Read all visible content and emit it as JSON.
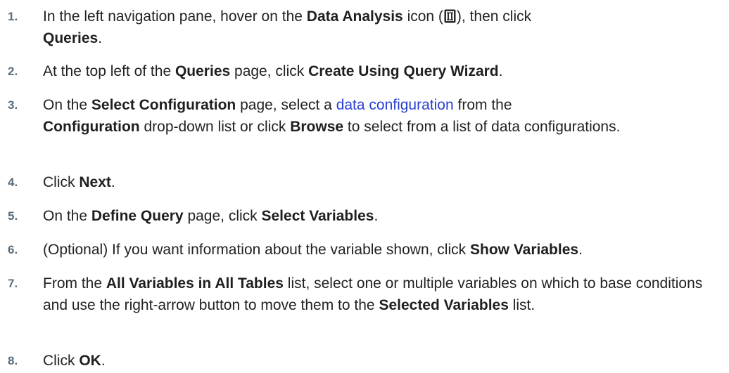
{
  "steps": [
    {
      "number": "1.",
      "l1": "In the left navigation pane, hover on the ",
      "b1": "Data Analysis",
      "l2": " icon (",
      "icon": "data-analysis-icon",
      "l3": "), then click ",
      "b2": "Queries",
      "l4": "."
    },
    {
      "number": "2.",
      "l1": "At the top left of the ",
      "b1": "Queries",
      "l2": " page, click ",
      "b2": "Create Using Query Wizard",
      "l3": "."
    },
    {
      "number": "3.",
      "l1": "On the ",
      "b1": "Select Configuration",
      "l2": " page, select a ",
      "link": "data configuration",
      "l3": " from the ",
      "b2": "Configuration",
      "l4": " drop-down list or click ",
      "b3": "Browse",
      "l5": " to select from a list of data configurations."
    },
    {
      "number": "4.",
      "l1": "Click ",
      "b1": "Next",
      "l2": "."
    },
    {
      "number": "5.",
      "l1": "On the ",
      "b1": "Define Query",
      "l2": " page, click ",
      "b2": "Select Variables",
      "l3": "."
    },
    {
      "number": "6.",
      "l1": "(Optional) If you want information about the variable shown, click ",
      "b1": "Show Variables",
      "l2": "."
    },
    {
      "number": "7.",
      "l1": "From the ",
      "b1": "All Variables in All Tables",
      "l2": " list, select one or multiple variables on which to base conditions and use the right-arrow button to move them to the ",
      "b2": "Selected Variables",
      "l3": " list."
    },
    {
      "number": "8.",
      "l1": "Click ",
      "b1": "OK",
      "l2": "."
    }
  ],
  "colors": {
    "number": "#5a6d7d",
    "link": "#2a3fd0",
    "text": "#222222"
  }
}
